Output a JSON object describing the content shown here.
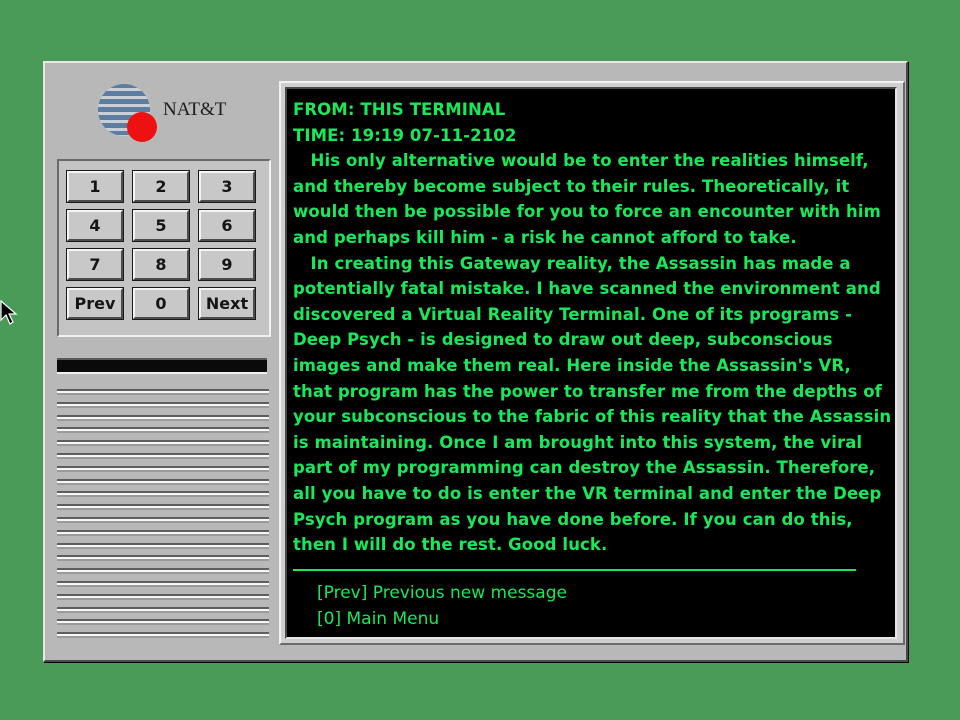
{
  "colors": {
    "background": "#4a9a58",
    "panel": "#b8b8b8",
    "screen": "#000000",
    "terminal_text": "#18e85a",
    "logo_red": "#ee1111",
    "logo_blue": "#5a7da0"
  },
  "logo": {
    "text": "NAT&T",
    "icon": "globe-logo-icon"
  },
  "keypad": {
    "keys": [
      "1",
      "2",
      "3",
      "4",
      "5",
      "6",
      "7",
      "8",
      "9",
      "Prev",
      "0",
      "Next"
    ]
  },
  "message": {
    "from": "FROM: THIS TERMINAL",
    "time": "TIME: 19:19 07-11-2102",
    "lines": [
      "   His only alternative would be to enter the realities himself,",
      "and thereby become subject to their rules. Theoretically, it",
      "would then be possible for you to force an encounter with him",
      "and perhaps kill him - a risk he cannot afford to take.",
      "   In creating this Gateway reality, the Assassin has made a",
      "potentially fatal mistake. I have scanned the environment and",
      "discovered a Virtual Reality Terminal. One of its programs -",
      "Deep Psych - is designed to draw out deep, subconscious",
      "images and make them real. Here inside the Assassin's VR,",
      "that program has the power to transfer me from the depths of",
      "your subconscious to the fabric of this reality that the Assassin",
      "is maintaining. Once I am brought into this system, the viral",
      "part of my programming can destroy the Assassin. Therefore,",
      "all you have to do is enter the VR terminal and enter the Deep",
      "Psych program as you have done before. If you can do this,",
      "then I will do the rest. Good luck."
    ]
  },
  "menu": {
    "items": [
      "[Prev] Previous new message",
      "[0] Main Menu"
    ]
  },
  "cursor": {
    "icon": "mouse-pointer-icon"
  }
}
